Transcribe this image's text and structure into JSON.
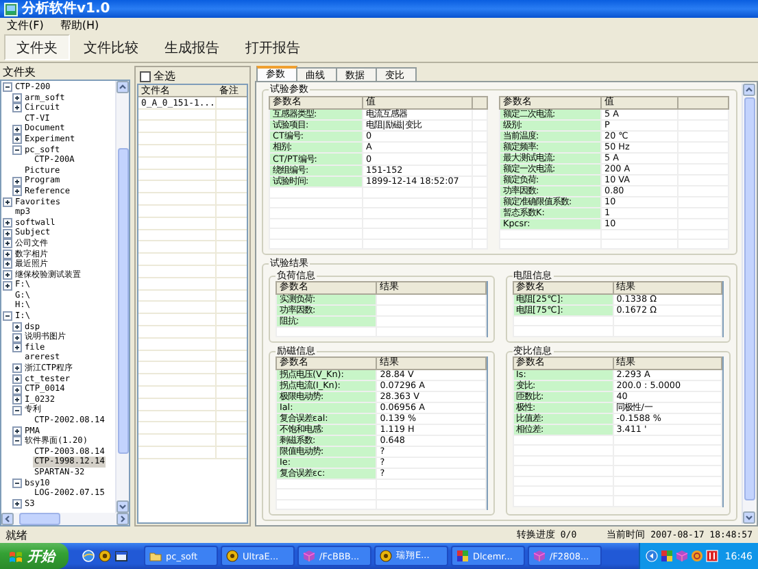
{
  "window": {
    "title": "分析软件v1.0"
  },
  "menu": [
    "文件(F)",
    "帮助(H)"
  ],
  "toolbar": [
    {
      "label": "文件夹",
      "selected": true
    },
    {
      "label": "文件比较",
      "selected": false
    },
    {
      "label": "生成报告",
      "selected": false
    },
    {
      "label": "打开报告",
      "selected": false
    }
  ],
  "folder_panel": {
    "title": "文件夹",
    "tree": [
      {
        "label": "CTP-200",
        "expanded": true,
        "selected": false,
        "children": [
          {
            "label": "arm_soft",
            "expanded": false,
            "selected": false
          },
          {
            "label": "Circuit",
            "expanded": false,
            "selected": false
          },
          {
            "label": "CT-VI",
            "selected": false
          },
          {
            "label": "Document",
            "expanded": false,
            "selected": false
          },
          {
            "label": "Experiment",
            "expanded": false,
            "selected": false
          },
          {
            "label": "pc_soft",
            "expanded": true,
            "selected": false,
            "children": [
              {
                "label": "CTP-200A",
                "selected": false
              }
            ]
          },
          {
            "label": "Picture",
            "selected": false
          },
          {
            "label": "Program",
            "expanded": false,
            "selected": false
          },
          {
            "label": "Reference",
            "expanded": false,
            "selected": false
          }
        ]
      },
      {
        "label": "Favorites",
        "expanded": false,
        "selected": false
      },
      {
        "label": "mp3",
        "selected": false
      },
      {
        "label": "softwall",
        "expanded": false,
        "selected": false
      },
      {
        "label": "Subject",
        "expanded": false,
        "selected": false
      },
      {
        "label": "公司文件",
        "expanded": false,
        "selected": false
      },
      {
        "label": "数字相片",
        "expanded": false,
        "selected": false
      },
      {
        "label": "最近照片",
        "expanded": false,
        "selected": false
      },
      {
        "label": "继保校验测试装置",
        "expanded": false,
        "selected": false
      },
      {
        "label": "F:\\",
        "expanded": false,
        "selected": false
      },
      {
        "label": "G:\\",
        "selected": false
      },
      {
        "label": "H:\\",
        "selected": false
      },
      {
        "label": "I:\\",
        "expanded": true,
        "selected": false,
        "children": [
          {
            "label": "dsp",
            "expanded": false,
            "selected": false
          },
          {
            "label": "说明书图片",
            "expanded": false,
            "selected": false
          },
          {
            "label": "file",
            "expanded": false,
            "selected": false
          },
          {
            "label": "arerest",
            "selected": false
          },
          {
            "label": "浙江CTP程序",
            "expanded": false,
            "selected": false
          },
          {
            "label": "ct_tester",
            "expanded": false,
            "selected": false
          },
          {
            "label": "CTP_0014",
            "expanded": false,
            "selected": false
          },
          {
            "label": "I_0232",
            "expanded": false,
            "selected": false
          },
          {
            "label": "专利",
            "expanded": true,
            "selected": false,
            "children": [
              {
                "label": "CTP-2002.08.14",
                "selected": false
              }
            ]
          },
          {
            "label": "PMA",
            "expanded": false,
            "selected": false
          },
          {
            "label": "软件界面(1.20)",
            "expanded": true,
            "selected": false,
            "children": [
              {
                "label": "CTP-2003.08.14",
                "selected": false
              },
              {
                "label": "CTP-1998.12.14",
                "selected": true
              },
              {
                "label": "SPARTAN-32",
                "selected": false
              }
            ]
          },
          {
            "label": "bsy10",
            "expanded": true,
            "selected": false,
            "children": [
              {
                "label": "LOG-2002.07.15",
                "selected": false
              }
            ]
          },
          {
            "label": "S3",
            "expanded": false,
            "selected": false
          }
        ]
      }
    ]
  },
  "file_list": {
    "select_all": {
      "label": "全选",
      "checked": false
    },
    "columns": [
      "文件名",
      "备注"
    ],
    "rows": [
      {
        "file": "0_A_0_151-1..."
      }
    ]
  },
  "tabs": [
    {
      "label": "参数",
      "selected": true
    },
    {
      "label": "曲线",
      "selected": false
    },
    {
      "label": "数据",
      "selected": false
    },
    {
      "label": "变比",
      "selected": false
    }
  ],
  "test_params": {
    "title": "试验参数",
    "tables": [
      {
        "columns": [
          "参数名",
          "值"
        ],
        "rows": [
          {
            "name": "互感器类型:",
            "value": "电流互感器"
          },
          {
            "name": "试验项目:",
            "value": "电阻|励磁|变比"
          },
          {
            "name": "CT编号:",
            "value": "0"
          },
          {
            "name": "相别:",
            "value": "A"
          },
          {
            "name": "CT/PT编号:",
            "value": "0"
          },
          {
            "name": "绕组编号:",
            "value": "151-152"
          },
          {
            "name": "试验时间:",
            "value": "1899-12-14 18:52:07"
          }
        ]
      },
      {
        "columns": [
          "参数名",
          "值"
        ],
        "rows": [
          {
            "name": "额定二次电流:",
            "value": "5 A"
          },
          {
            "name": "级别:",
            "value": "P"
          },
          {
            "name": "当前温度:",
            "value": "20 ℃"
          },
          {
            "name": "额定频率:",
            "value": "50 Hz"
          },
          {
            "name": "最大测试电流:",
            "value": "5 A"
          },
          {
            "name": "额定一次电流:",
            "value": "200 A"
          },
          {
            "name": "额定负荷:",
            "value": "10 VA"
          },
          {
            "name": "功率因数:",
            "value": "0.80"
          },
          {
            "name": "额定准确限值系数:",
            "value": "10"
          },
          {
            "name": "暂态系数K:",
            "value": "1"
          },
          {
            "name": "Kpcsr:",
            "value": "10"
          }
        ]
      }
    ]
  },
  "results": {
    "title": "试验结果",
    "groups": [
      {
        "title": "负荷信息",
        "columns": [
          "参数名",
          "结果"
        ],
        "rows": [
          {
            "name": "实测负荷:"
          },
          {
            "name": "功率因数:"
          },
          {
            "name": "阻抗:"
          }
        ]
      },
      {
        "title": "电阻信息",
        "columns": [
          "参数名",
          "结果"
        ],
        "rows": [
          {
            "name": "电阻[25℃]:",
            "value": "0.1338 Ω"
          },
          {
            "name": "电阻[75℃]:",
            "value": "0.1672 Ω"
          }
        ]
      },
      {
        "title": "励磁信息",
        "columns": [
          "参数名",
          "结果"
        ],
        "rows": [
          {
            "name": "拐点电压(V_Kn):",
            "value": "28.84 V"
          },
          {
            "name": "拐点电流(I_Kn):",
            "value": "0.07296 A"
          },
          {
            "name": "极限电动势:",
            "value": "28.363 V"
          },
          {
            "name": "Ial:",
            "value": "0.06956 A"
          },
          {
            "name": "复合误差εal:",
            "value": "0.139 %"
          },
          {
            "name": "不饱和电感:",
            "value": "1.119 H"
          },
          {
            "name": "剩磁系数:",
            "value": "0.648"
          },
          {
            "name": "限值电动势:",
            "value": "?"
          },
          {
            "name": "Ie:",
            "value": "?"
          },
          {
            "name": "复合误差εc:",
            "value": "?"
          }
        ]
      },
      {
        "title": "变比信息",
        "columns": [
          "参数名",
          "结果"
        ],
        "rows": [
          {
            "name": "Is:",
            "value": "2.293 A"
          },
          {
            "name": "变比:",
            "value": "200.0 : 5.0000"
          },
          {
            "name": "匝数比:",
            "value": "40"
          },
          {
            "name": "极性:",
            "value": "同极性/一"
          },
          {
            "name": "比值差:",
            "value": "-0.1588 %"
          },
          {
            "name": "相位差:",
            "value": "3.411 '"
          }
        ]
      }
    ]
  },
  "status_bar": {
    "message": "就绪",
    "progress_label": "转换进度",
    "progress": "0/0",
    "time_label": "当前时间",
    "time": "2007-08-17 18:48:57"
  },
  "taskbar": {
    "start": "开始",
    "tasks": [
      {
        "label": "pc_soft",
        "kind": "folder"
      },
      {
        "label": "UltraE...",
        "kind": "app"
      },
      {
        "label": "/FcBBB...",
        "kind": "cube"
      },
      {
        "label": "瑞翔E...",
        "kind": "app"
      },
      {
        "label": "Dlcemr...",
        "kind": "blocks"
      },
      {
        "label": "/F2808...",
        "kind": "cube"
      }
    ],
    "clock": "16:46"
  }
}
